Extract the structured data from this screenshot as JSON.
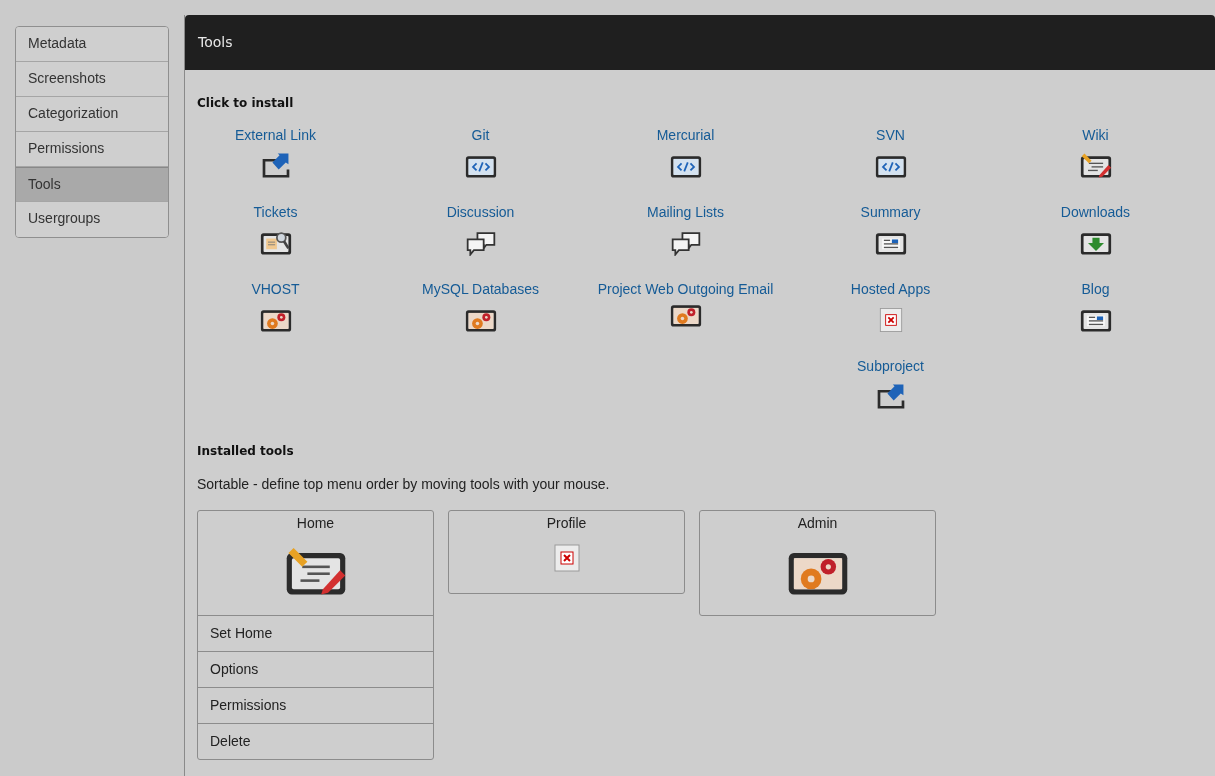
{
  "sidebar": {
    "items": [
      {
        "label": "Metadata",
        "selected": false
      },
      {
        "label": "Screenshots",
        "selected": false
      },
      {
        "label": "Categorization",
        "selected": false
      },
      {
        "label": "Permissions",
        "selected": false
      },
      {
        "label": "Tools",
        "selected": true
      },
      {
        "label": "Usergroups",
        "selected": false
      }
    ]
  },
  "panel": {
    "title": "Tools",
    "install": {
      "heading": "Click to install",
      "tools": [
        {
          "label": "External Link",
          "kind": "link"
        },
        {
          "label": "Git",
          "kind": "code"
        },
        {
          "label": "Mercurial",
          "kind": "code"
        },
        {
          "label": "SVN",
          "kind": "code"
        },
        {
          "label": "Wiki",
          "kind": "wiki"
        },
        {
          "label": "Tickets",
          "kind": "tickets"
        },
        {
          "label": "Discussion",
          "kind": "discussion"
        },
        {
          "label": "Mailing Lists",
          "kind": "discussion"
        },
        {
          "label": "Summary",
          "kind": "summary"
        },
        {
          "label": "Downloads",
          "kind": "download"
        },
        {
          "label": "VHOST",
          "kind": "gears"
        },
        {
          "label": "MySQL Databases",
          "kind": "gears"
        },
        {
          "label": "Project Web Outgoing Email",
          "kind": "gears"
        },
        {
          "label": "Hosted Apps",
          "kind": "broken"
        },
        {
          "label": "Blog",
          "kind": "summary"
        },
        {
          "label": "Subproject",
          "kind": "link"
        }
      ]
    },
    "installed": {
      "heading": "Installed tools",
      "note": "Sortable - define top menu order by moving tools with your mouse.",
      "tools": [
        {
          "label": "Home",
          "kind": "wiki",
          "menu": [
            "Set Home",
            "Options",
            "Permissions",
            "Delete"
          ]
        },
        {
          "label": "Profile",
          "kind": "broken"
        },
        {
          "label": "Admin",
          "kind": "gears"
        }
      ]
    }
  }
}
